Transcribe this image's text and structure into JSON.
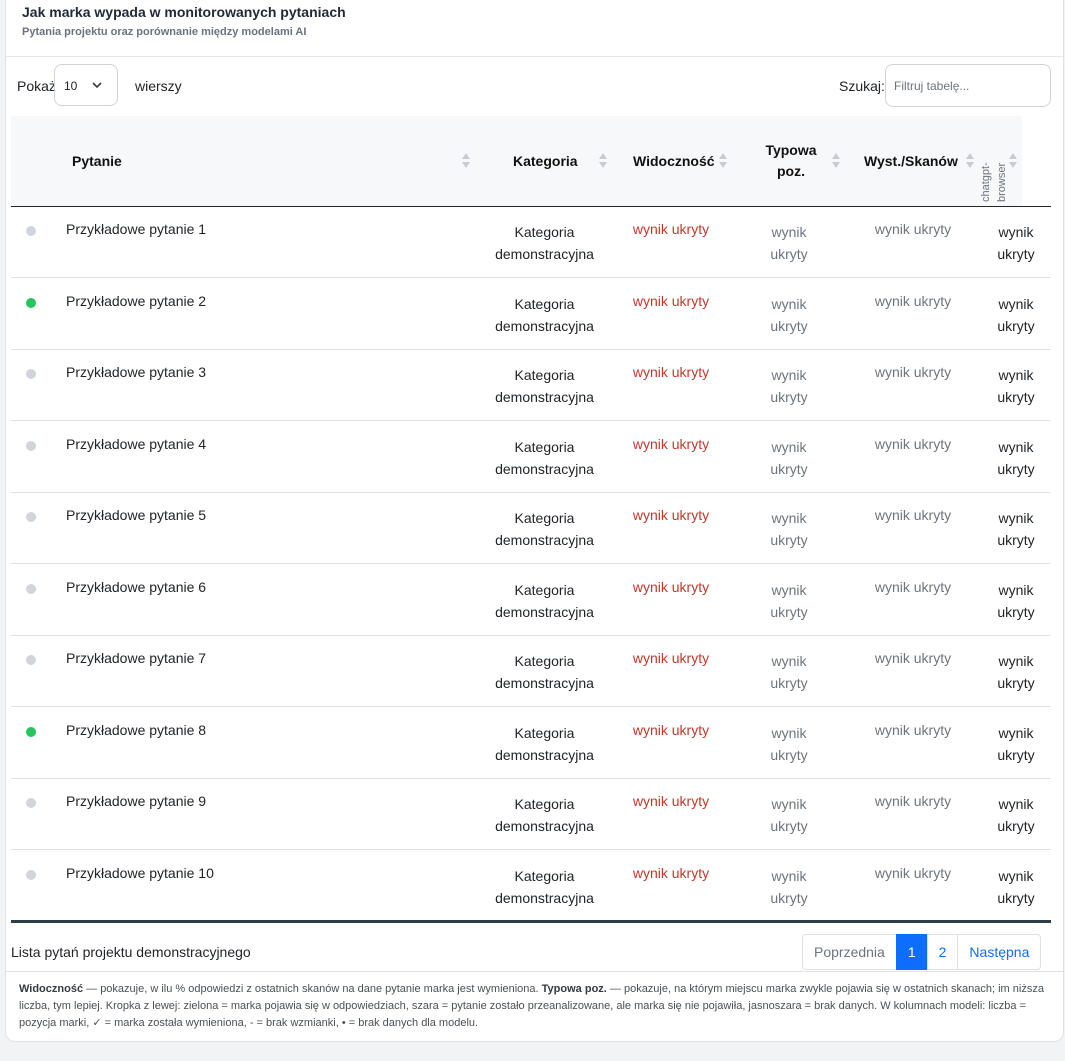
{
  "header": {
    "title": "Jak marka wypada w monitorowanych pytaniach",
    "subtitle": "Pytania projektu oraz porównanie między modelami AI"
  },
  "controls": {
    "show_label": "Pokaż",
    "page_size": "10",
    "rows_label": "wierszy",
    "search_label": "Szukaj:",
    "search_placeholder": "Filtruj tabelę...",
    "search_value": ""
  },
  "table": {
    "columns": {
      "question": "Pytanie",
      "category": "Kategoria",
      "visibility": "Widoczność",
      "typical_pos": "Typowa poz.",
      "appearances": "Wyst./Skanów",
      "model": "chatgpt-browser"
    },
    "rows": [
      {
        "dot": "grey",
        "question": "Przykładowe pytanie 1",
        "category": "Kategoria demonstracyjna",
        "visibility": "wynik ukryty",
        "typical_pos": "wynik ukryty",
        "appearances": "wynik ukryty",
        "model": "wynik ukryty"
      },
      {
        "dot": "green",
        "question": "Przykładowe pytanie 2",
        "category": "Kategoria demonstracyjna",
        "visibility": "wynik ukryty",
        "typical_pos": "wynik ukryty",
        "appearances": "wynik ukryty",
        "model": "wynik ukryty"
      },
      {
        "dot": "grey",
        "question": "Przykładowe pytanie 3",
        "category": "Kategoria demonstracyjna",
        "visibility": "wynik ukryty",
        "typical_pos": "wynik ukryty",
        "appearances": "wynik ukryty",
        "model": "wynik ukryty"
      },
      {
        "dot": "grey",
        "question": "Przykładowe pytanie 4",
        "category": "Kategoria demonstracyjna",
        "visibility": "wynik ukryty",
        "typical_pos": "wynik ukryty",
        "appearances": "wynik ukryty",
        "model": "wynik ukryty"
      },
      {
        "dot": "grey",
        "question": "Przykładowe pytanie 5",
        "category": "Kategoria demonstracyjna",
        "visibility": "wynik ukryty",
        "typical_pos": "wynik ukryty",
        "appearances": "wynik ukryty",
        "model": "wynik ukryty"
      },
      {
        "dot": "grey",
        "question": "Przykładowe pytanie 6",
        "category": "Kategoria demonstracyjna",
        "visibility": "wynik ukryty",
        "typical_pos": "wynik ukryty",
        "appearances": "wynik ukryty",
        "model": "wynik ukryty"
      },
      {
        "dot": "grey",
        "question": "Przykładowe pytanie 7",
        "category": "Kategoria demonstracyjna",
        "visibility": "wynik ukryty",
        "typical_pos": "wynik ukryty",
        "appearances": "wynik ukryty",
        "model": "wynik ukryty"
      },
      {
        "dot": "green",
        "question": "Przykładowe pytanie 8",
        "category": "Kategoria demonstracyjna",
        "visibility": "wynik ukryty",
        "typical_pos": "wynik ukryty",
        "appearances": "wynik ukryty",
        "model": "wynik ukryty"
      },
      {
        "dot": "grey",
        "question": "Przykładowe pytanie 9",
        "category": "Kategoria demonstracyjna",
        "visibility": "wynik ukryty",
        "typical_pos": "wynik ukryty",
        "appearances": "wynik ukryty",
        "model": "wynik ukryty"
      },
      {
        "dot": "grey",
        "question": "Przykładowe pytanie 10",
        "category": "Kategoria demonstracyjna",
        "visibility": "wynik ukryty",
        "typical_pos": "wynik ukryty",
        "appearances": "wynik ukryty",
        "model": "wynik ukryty"
      }
    ]
  },
  "footer": {
    "caption": "Lista pytań projektu demonstracyjnego",
    "pagination": {
      "prev": "Poprzednia",
      "pages": [
        "1",
        "2"
      ],
      "active_page": "1",
      "next": "Następna"
    }
  },
  "legend": {
    "vis_term": "Widoczność",
    "vis_text": " — pokazuje, w ilu % odpowiedzi z ostatnich skanów na dane pytanie marka jest wymieniona. ",
    "pos_term": "Typowa poz.",
    "pos_text": " — pokazuje, na którym miejscu marka zwykle pojawia się w ostatnich skanach; im niższa liczba, tym lepiej. Kropka z lewej: zielona = marka pojawia się w odpowiedziach, szara = pytanie zostało przeanalizowane, ale marka się nie pojawiła, jasnoszara = brak danych. W kolumnach modeli: liczba = pozycja marki, ✓ = marka została wymieniona, - = brak wzmianki, • = brak danych dla modelu."
  },
  "colors": {
    "dot_green": "#22c55e",
    "dot_grey": "#d1d5db",
    "visibility_text": "#c0392b",
    "active_page": "#0d6efd"
  }
}
